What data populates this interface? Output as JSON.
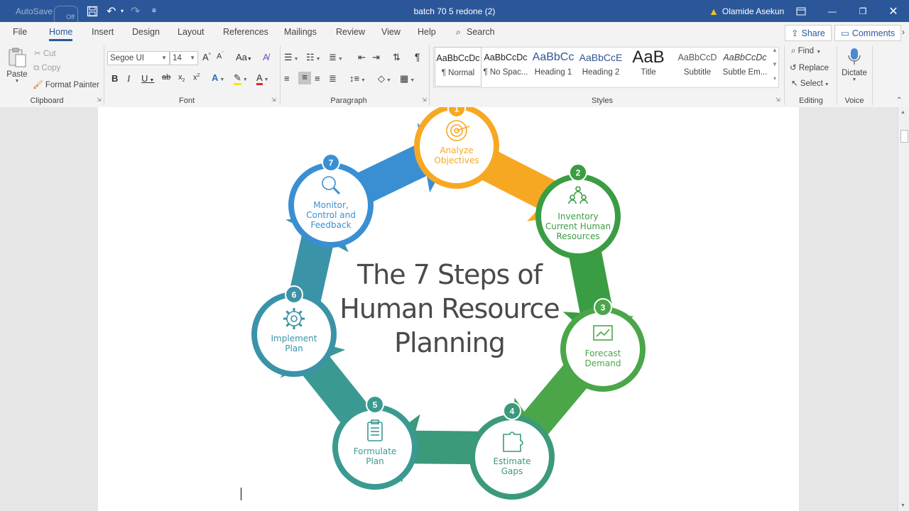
{
  "titlebar": {
    "autosave": "AutoSave",
    "autosave_state": "Off",
    "doc_title": "batch 70 5 redone (2)",
    "user": "Olamide Asekun"
  },
  "menu": {
    "tabs": [
      "File",
      "Home",
      "Insert",
      "Design",
      "Layout",
      "References",
      "Mailings",
      "Review",
      "View",
      "Help"
    ],
    "active": "Home",
    "search": "Search",
    "share": "Share",
    "comments": "Comments"
  },
  "clipboard": {
    "paste": "Paste",
    "cut": "Cut",
    "copy": "Copy",
    "format_painter": "Format Painter",
    "label": "Clipboard"
  },
  "font": {
    "family": "Segoe UI",
    "size": "14",
    "label": "Font"
  },
  "paragraph": {
    "label": "Paragraph"
  },
  "styles": {
    "label": "Styles",
    "items": [
      {
        "preview": "AaBbCcDc",
        "name": "¶ Normal"
      },
      {
        "preview": "AaBbCcDc",
        "name": "¶ No Spac..."
      },
      {
        "preview": "AaBbCc",
        "name": "Heading 1"
      },
      {
        "preview": "AaBbCcE",
        "name": "Heading 2"
      },
      {
        "preview": "AaB",
        "name": "Title"
      },
      {
        "preview": "AaBbCcD",
        "name": "Subtitle"
      },
      {
        "preview": "AaBbCcDc",
        "name": "Subtle Em..."
      }
    ]
  },
  "editing": {
    "find": "Find",
    "replace": "Replace",
    "select": "Select",
    "label": "Editing"
  },
  "voice": {
    "dictate": "Dictate",
    "label": "Voice"
  },
  "infographic": {
    "title_lines": [
      "The 7 Steps of",
      "Human Resource",
      "Planning"
    ],
    "steps": [
      {
        "num": "1",
        "lines": [
          "Analyze",
          "Objectives"
        ],
        "color": "#f7a823",
        "icon": "target-icon"
      },
      {
        "num": "2",
        "lines": [
          "Inventory",
          "Current Human",
          "Resources"
        ],
        "color": "#3a9d43",
        "icon": "people-icon"
      },
      {
        "num": "3",
        "lines": [
          "Forecast",
          "Demand"
        ],
        "color": "#4aa649",
        "icon": "chart-icon"
      },
      {
        "num": "4",
        "lines": [
          "Estimate",
          "Gaps"
        ],
        "color": "#3a9a7a",
        "icon": "puzzle-icon"
      },
      {
        "num": "5",
        "lines": [
          "Formulate",
          "Plan"
        ],
        "color": "#3a9a92",
        "icon": "clipboard-icon"
      },
      {
        "num": "6",
        "lines": [
          "Implement",
          "Plan"
        ],
        "color": "#3b93a8",
        "icon": "gear-icon"
      },
      {
        "num": "7",
        "lines": [
          "Monitor,",
          "Control and",
          "Feedback"
        ],
        "color": "#3a8fd2",
        "icon": "magnifier-icon"
      }
    ]
  }
}
